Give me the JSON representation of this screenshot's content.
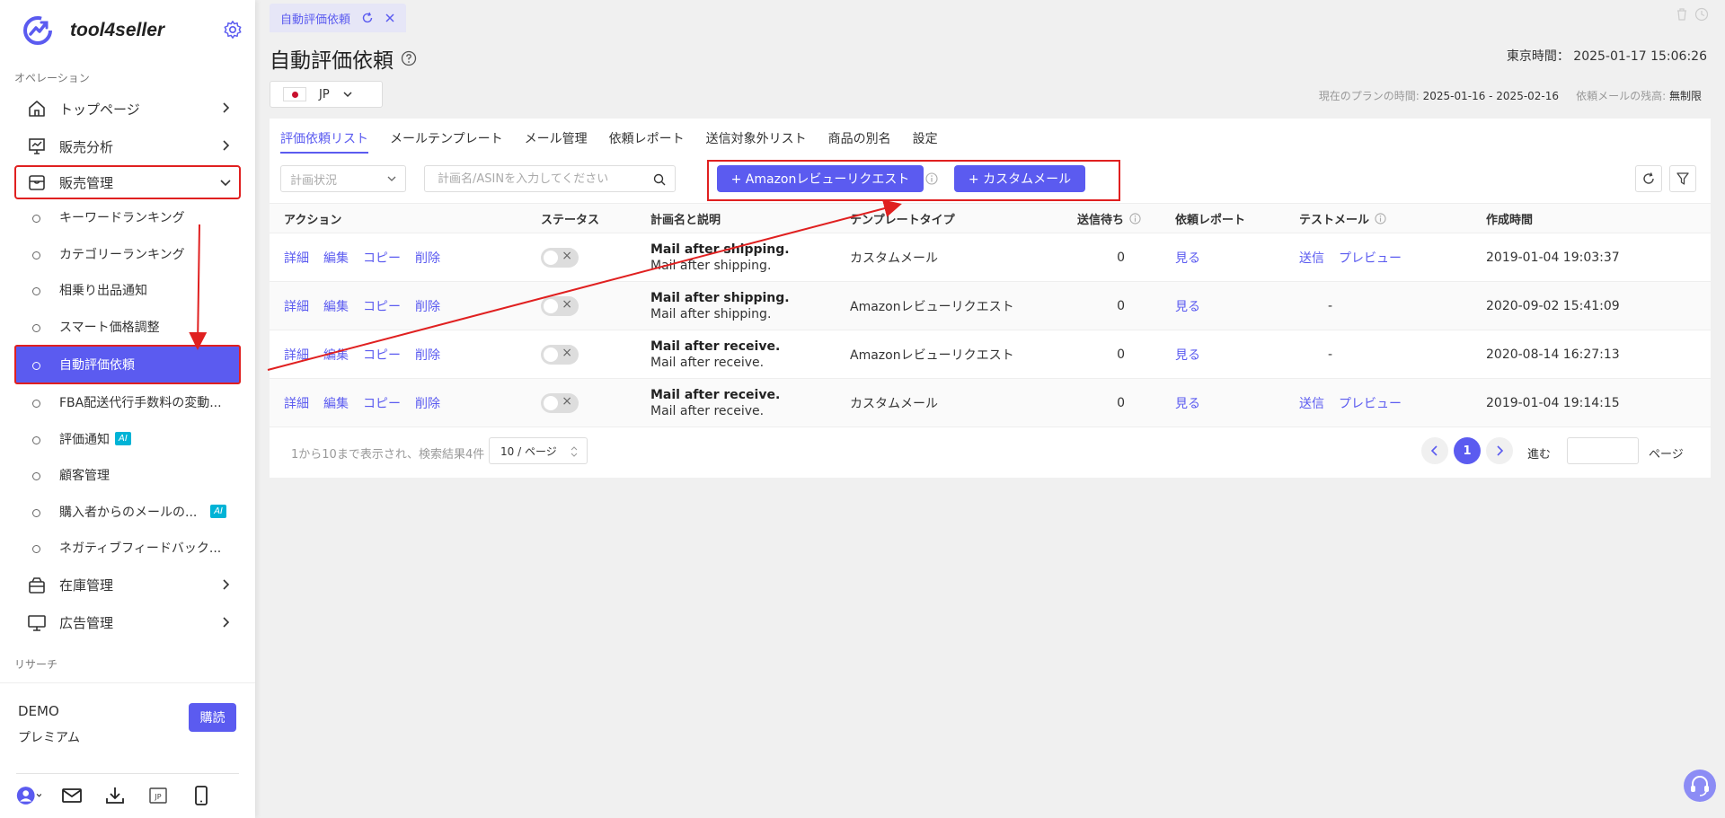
{
  "app": {
    "name": "tool4seller"
  },
  "sidebar": {
    "section_operations": "オペレーション",
    "section_research": "リサーチ",
    "items": [
      {
        "label": "トップページ"
      },
      {
        "label": "販売分析"
      },
      {
        "label": "販売管理"
      }
    ],
    "sub_items": [
      {
        "label": "キーワードランキング"
      },
      {
        "label": "カテゴリーランキング"
      },
      {
        "label": "相乗り出品通知"
      },
      {
        "label": "スマート価格調整"
      },
      {
        "label": "自動評価依頼"
      },
      {
        "label": "FBA配送代行手数料の変動..."
      },
      {
        "label": "評価通知",
        "badge": "AI"
      },
      {
        "label": "顧客管理"
      },
      {
        "label": "購入者からのメールの...",
        "badge": "AI"
      },
      {
        "label": "ネガティブフィードバック..."
      }
    ],
    "items_after": [
      {
        "label": "在庫管理"
      },
      {
        "label": "広告管理"
      }
    ],
    "account": {
      "name": "DEMO",
      "plan": "プレミアム",
      "subscribe_label": "購読"
    },
    "bottom_icons": [
      "user-icon",
      "mail-icon",
      "download-icon",
      "jp-icon",
      "phone-icon"
    ]
  },
  "tab": {
    "label": "自動評価依頼"
  },
  "page": {
    "title": "自動評価依頼",
    "clock_label": "東京時間：",
    "clock_value": "2025-01-17 15:06:26",
    "country": "JP",
    "plan_label": "現在のプランの時間:",
    "plan_value": "2025-01-16 - 2025-02-16",
    "remaining_label": "依頼メールの残高:",
    "remaining_value": "無制限"
  },
  "subtabs": [
    "評価依頼リスト",
    "メールテンプレート",
    "メール管理",
    "依頼レポート",
    "送信対象外リスト",
    "商品の別名",
    "設定"
  ],
  "filters": {
    "status_placeholder": "計画状況",
    "search_placeholder": "計画名/ASINを入力してください",
    "btn_amazon": "+ Amazonレビューリクエスト",
    "btn_custom": "+ カスタムメール"
  },
  "table": {
    "headers": {
      "action": "アクション",
      "status": "ステータス",
      "plan": "計画名と説明",
      "template": "テンプレートタイプ",
      "pending": "送信待ち",
      "report": "依頼レポート",
      "test": "テストメール",
      "created": "作成時間"
    },
    "action_labels": {
      "detail": "詳細",
      "edit": "編集",
      "copy": "コピー",
      "delete": "削除"
    },
    "rows": [
      {
        "name": "Mail after shipping.",
        "desc": "Mail after shipping.",
        "template": "カスタムメール",
        "pending": "0",
        "report": "見る",
        "send": "送信",
        "preview": "プレビュー",
        "dash": "",
        "created": "2019-01-04 19:03:37"
      },
      {
        "name": "Mail after shipping.",
        "desc": "Mail after shipping.",
        "template": "Amazonレビューリクエスト",
        "pending": "0",
        "report": "見る",
        "send": "",
        "preview": "",
        "dash": "-",
        "created": "2020-09-02 15:41:09"
      },
      {
        "name": "Mail after receive.",
        "desc": "Mail after receive.",
        "template": "Amazonレビューリクエスト",
        "pending": "0",
        "report": "見る",
        "send": "",
        "preview": "",
        "dash": "-",
        "created": "2020-08-14 16:27:13"
      },
      {
        "name": "Mail after receive.",
        "desc": "Mail after receive.",
        "template": "カスタムメール",
        "pending": "0",
        "report": "見る",
        "send": "送信",
        "preview": "プレビュー",
        "dash": "",
        "created": "2019-01-04 19:14:15"
      }
    ]
  },
  "pager": {
    "summary": "1から10まで表示され、検索結果4件",
    "page_size": "10 / ページ",
    "current_page": "1",
    "go_label": "進む",
    "page_unit": "ページ"
  },
  "colors": {
    "accent": "#5b5bf0",
    "highlight": "#e02020",
    "ai_badge": "#00b3d6"
  }
}
